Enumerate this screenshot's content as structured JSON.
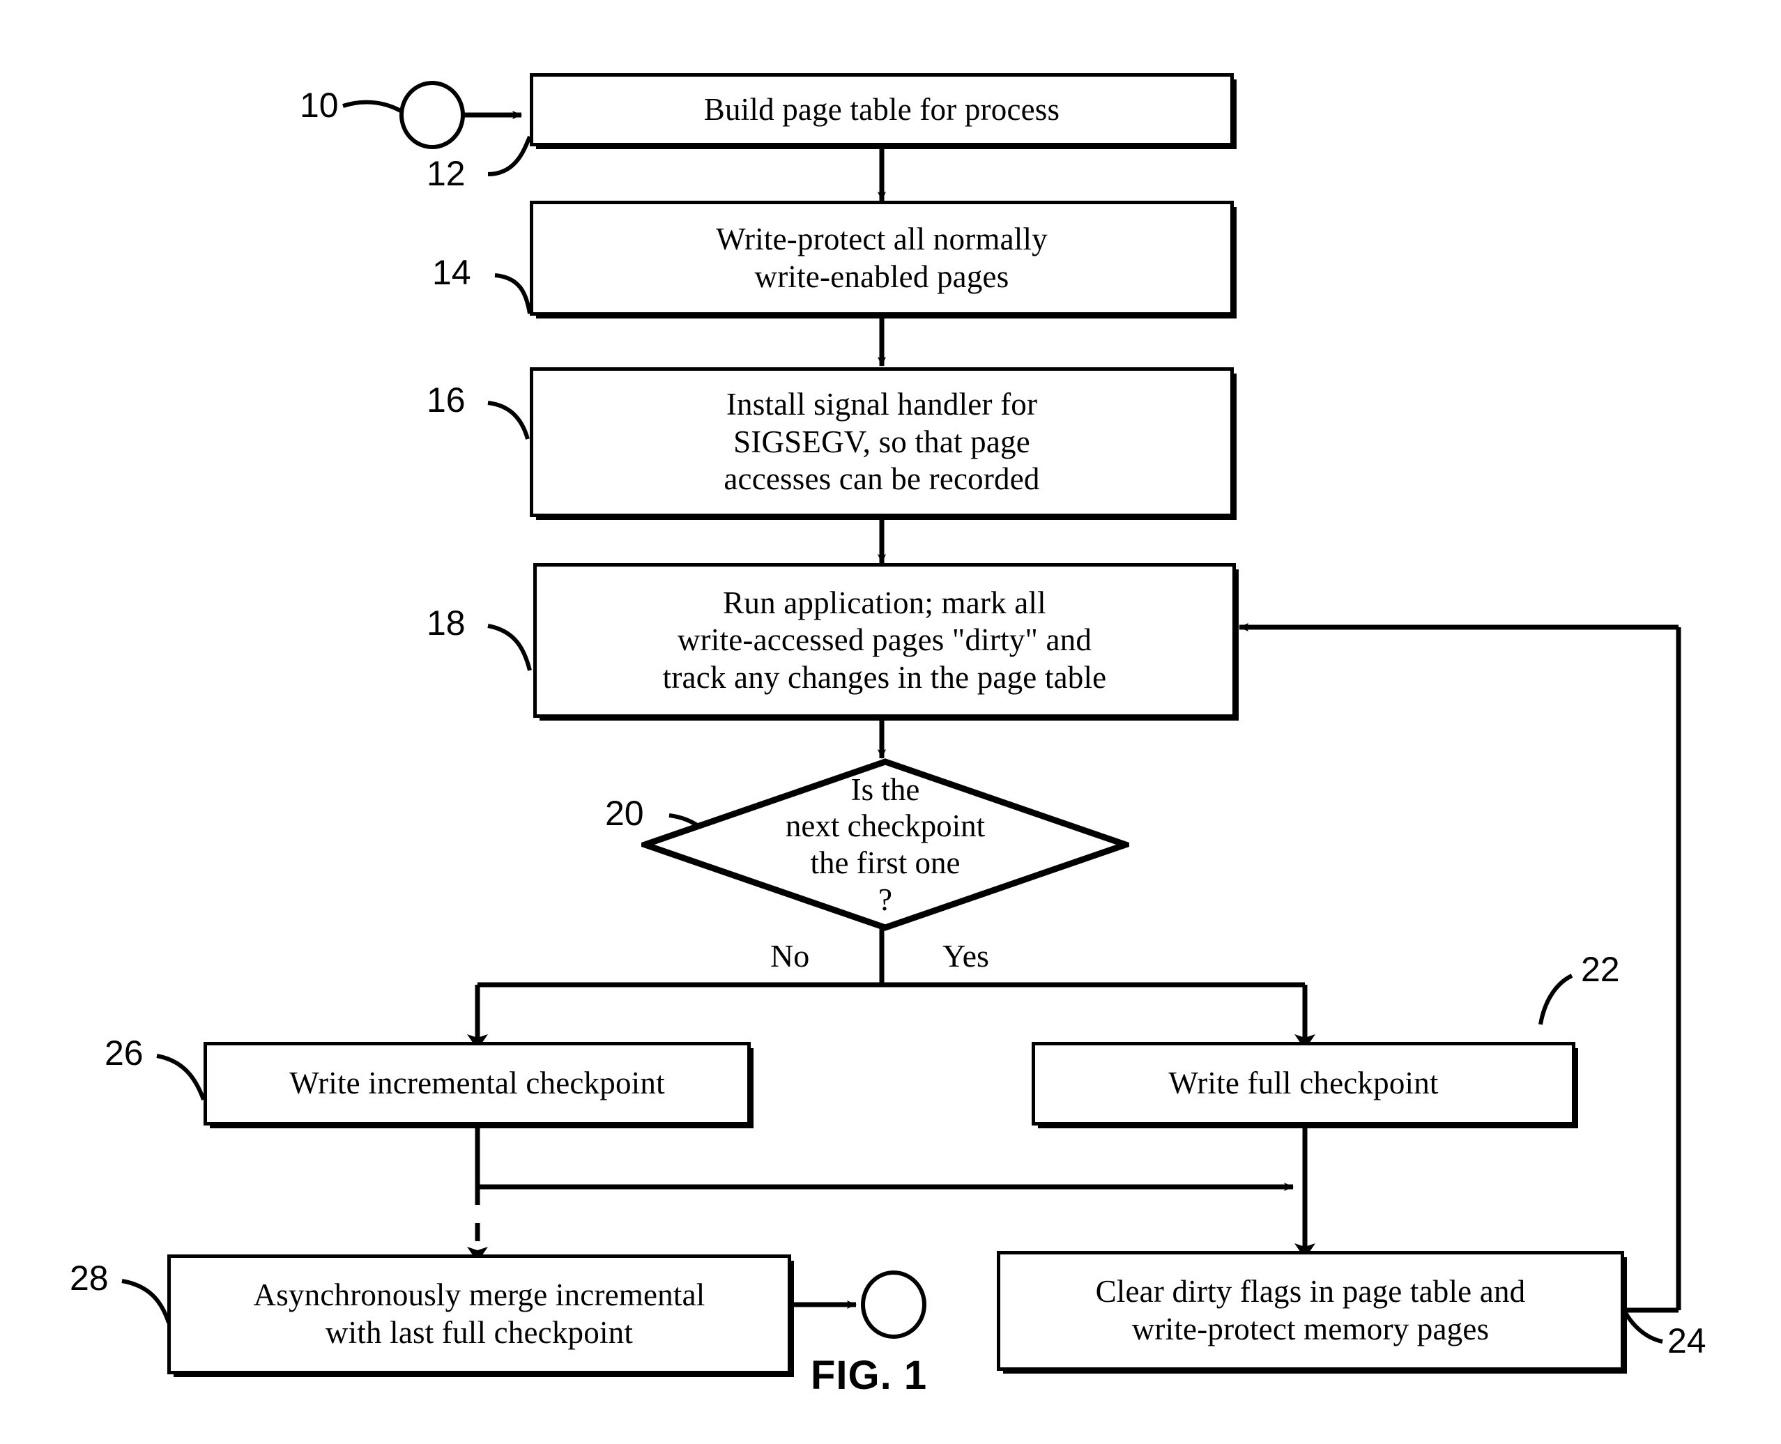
{
  "figure": {
    "caption": "FIG. 1",
    "type": "flowchart"
  },
  "nodes": {
    "start_terminal": {
      "ref": "10",
      "shape": "circle",
      "label": ""
    },
    "build_page_table": {
      "ref": "12",
      "shape": "process",
      "text": "Build page table for process"
    },
    "write_protect": {
      "ref": "14",
      "shape": "process",
      "text": "Write-protect all normally\nwrite-enabled pages"
    },
    "install_handler": {
      "ref": "16",
      "shape": "process",
      "text": "Install signal handler for\nSIGSEGV, so that page\naccesses can be recorded"
    },
    "run_application": {
      "ref": "18",
      "shape": "process",
      "text": "Run application; mark all\nwrite-accessed pages \"dirty\" and\ntrack any changes in the page table"
    },
    "decision_first_checkpoint": {
      "ref": "20",
      "shape": "decision",
      "text": "Is  the\nnext checkpoint\nthe first one\n?"
    },
    "write_full_checkpoint": {
      "ref": "22",
      "shape": "process",
      "text": "Write full checkpoint"
    },
    "clear_dirty_flags": {
      "ref": "24",
      "shape": "process",
      "text": "Clear dirty flags in page table and\nwrite-protect memory pages"
    },
    "write_incremental_checkpoint": {
      "ref": "26",
      "shape": "process",
      "text": "Write incremental checkpoint"
    },
    "merge_incremental": {
      "ref": "28",
      "shape": "process",
      "text": "Asynchronously merge incremental\nwith last full checkpoint"
    },
    "end_terminal": {
      "shape": "circle",
      "label": ""
    }
  },
  "branch_labels": {
    "no": "No",
    "yes": "Yes"
  },
  "colors": {
    "line": "#000000",
    "background": "#ffffff",
    "text": "#000000"
  }
}
